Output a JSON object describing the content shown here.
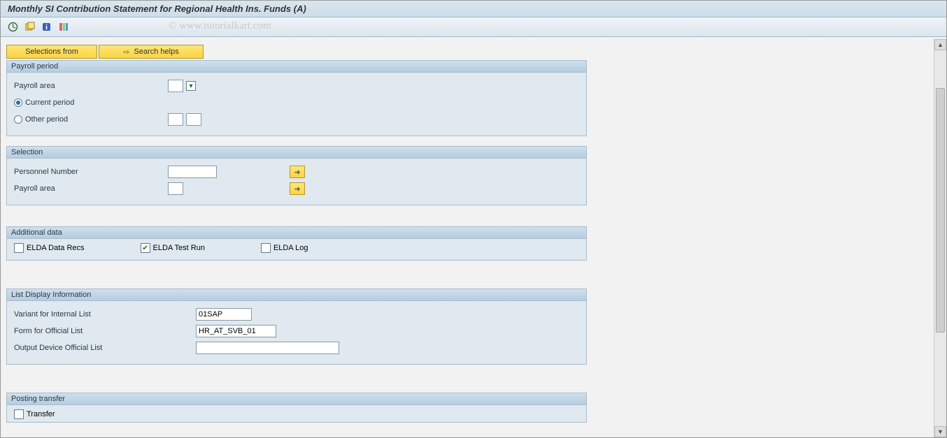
{
  "title": "Monthly SI Contribution Statement for Regional Health Ins. Funds (A)",
  "watermark": "© www.tutorialkart.com",
  "toolbar": {
    "icons": [
      "execute-icon",
      "variant-icon",
      "info-icon",
      "layout-icon"
    ],
    "selections_from": "Selections from",
    "search_helps": "Search helps"
  },
  "groups": {
    "payroll_period": {
      "title": "Payroll period",
      "payroll_area_label": "Payroll area",
      "payroll_area_value": "",
      "current_period_label": "Current period",
      "current_period_selected": true,
      "other_period_label": "Other period",
      "other_period_selected": false,
      "other_period_v1": "",
      "other_period_v2": ""
    },
    "selection": {
      "title": "Selection",
      "personnel_number_label": "Personnel Number",
      "personnel_number_value": "",
      "payroll_area_label": "Payroll area",
      "payroll_area_value": ""
    },
    "additional_data": {
      "title": "Additional data",
      "elda_recs_label": "ELDA Data Recs",
      "elda_recs_checked": false,
      "elda_test_label": "ELDA Test Run",
      "elda_test_checked": true,
      "elda_log_label": "ELDA Log",
      "elda_log_checked": false
    },
    "list_display": {
      "title": "List Display Information",
      "variant_label": "Variant for Internal List",
      "variant_value": "01SAP",
      "form_label": "Form for Official List",
      "form_value": "HR_AT_SVB_01",
      "output_label": "Output Device Official List",
      "output_value": ""
    },
    "posting": {
      "title": "Posting transfer",
      "transfer_label": "Transfer",
      "transfer_checked": false
    }
  }
}
